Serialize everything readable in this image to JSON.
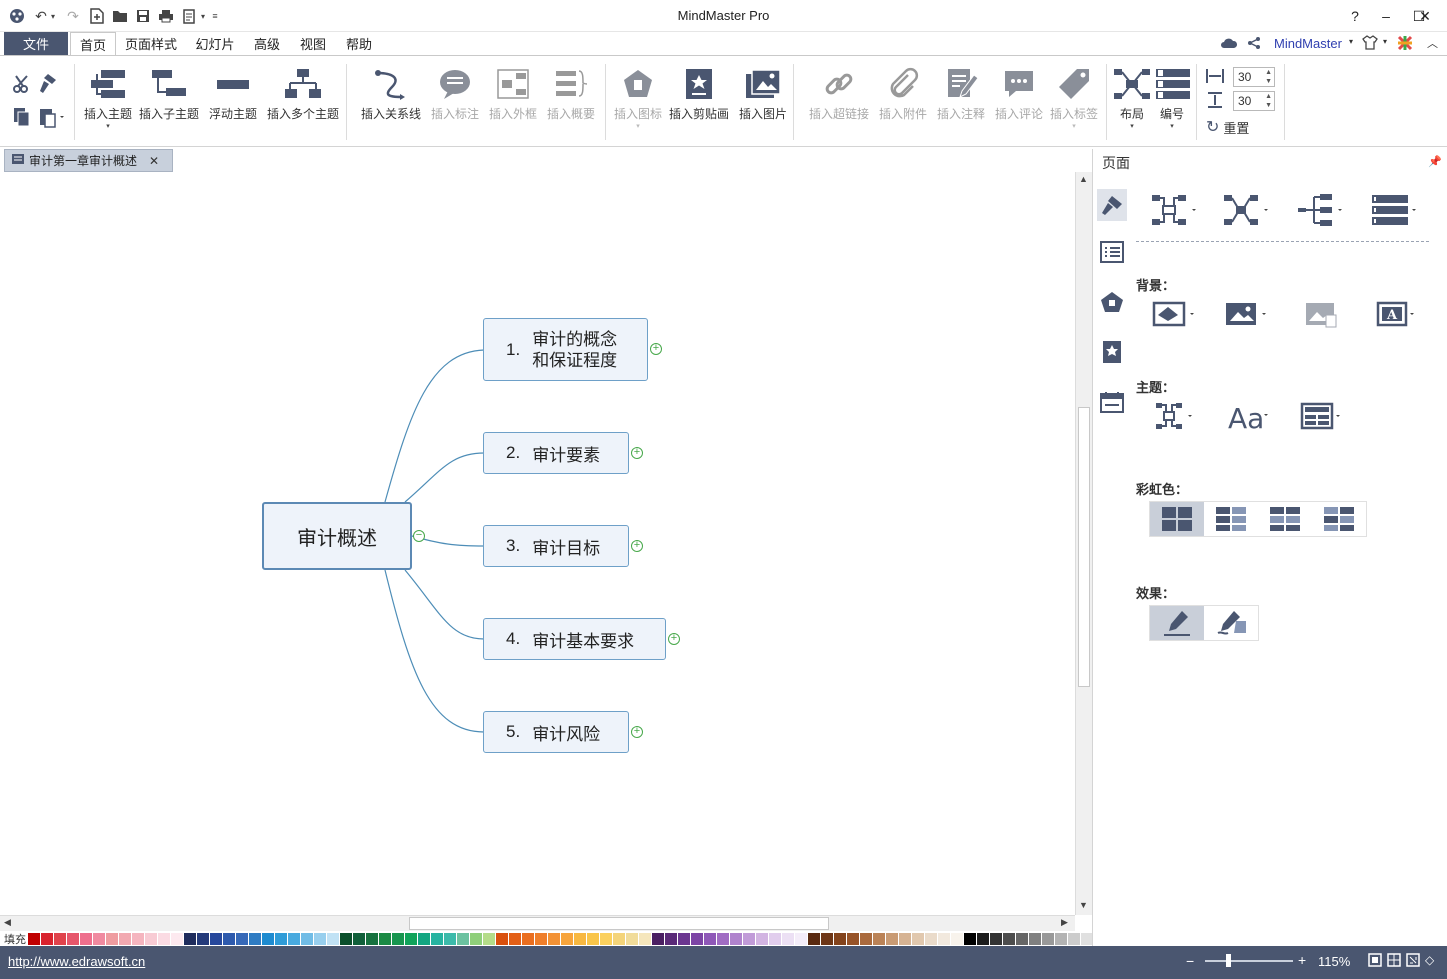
{
  "window": {
    "title": "MindMaster Pro"
  },
  "menu": {
    "file": "文件",
    "tabs": [
      "首页",
      "页面样式",
      "幻灯片",
      "高级",
      "视图",
      "帮助"
    ],
    "brand": "MindMaster"
  },
  "ribbon": {
    "insert_topic": "插入主题",
    "insert_subtopic": "插入子主题",
    "floating_topic": "浮动主题",
    "insert_multiple": "插入多个主题",
    "insert_relation": "插入关系线",
    "insert_callout": "插入标注",
    "insert_boundary": "插入外框",
    "insert_summary": "插入概要",
    "insert_icon": "插入图标",
    "insert_clipart": "插入剪贴画",
    "insert_image": "插入图片",
    "insert_hyperlink": "插入超链接",
    "insert_attachment": "插入附件",
    "insert_note": "插入注释",
    "insert_comment": "插入评论",
    "insert_tag": "插入标签",
    "layout": "布局",
    "numbering": "编号",
    "spacing_h": "30",
    "spacing_v": "30",
    "reset": "重置"
  },
  "doc_tab": {
    "label": "审计第一章审计概述"
  },
  "mindmap": {
    "central": "审计概述",
    "topics": [
      {
        "num": "1.",
        "line1": "审计的概念",
        "line2": "和保证程度"
      },
      {
        "num": "2.",
        "line1": "审计要素"
      },
      {
        "num": "3.",
        "line1": "审计目标"
      },
      {
        "num": "4.",
        "line1": "审计基本要求"
      },
      {
        "num": "5.",
        "line1": "审计风险"
      }
    ]
  },
  "panel": {
    "title": "页面",
    "background": "背景：",
    "theme": "主题：",
    "rainbow": "彩虹色：",
    "effect": "效果："
  },
  "palette": {
    "label": "填充"
  },
  "status": {
    "url": "http://www.edrawsoft.cn",
    "zoom": "115%"
  },
  "colors": {
    "accent": "#4a5670",
    "node_border": "#6ea0c8",
    "node_fill": "#eef3fa",
    "expand": "#47a84a",
    "icon": "#4a5670"
  }
}
